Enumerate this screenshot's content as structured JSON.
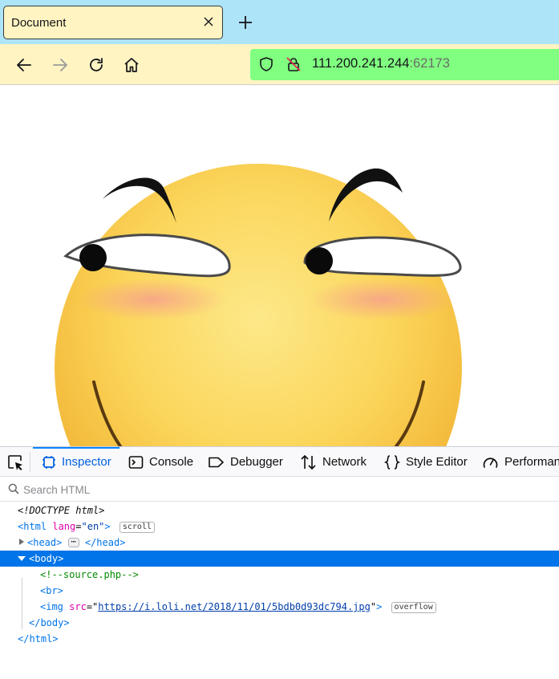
{
  "browser": {
    "tab_title": "Document",
    "nav": {
      "back_icon": "back-arrow-icon",
      "forward_icon": "forward-arrow-icon",
      "reload_icon": "reload-icon",
      "home_icon": "home-icon"
    },
    "url": {
      "host": "111.200.241.244",
      "port": ":62173"
    },
    "colors": {
      "tabstrip": "#aee4f8",
      "toolbar": "#fff4c2",
      "urlbar": "#80ff80"
    }
  },
  "page": {
    "image": {
      "alt_icon": "smirking-face-emoji"
    }
  },
  "devtools": {
    "tabs": [
      {
        "label": "Inspector",
        "icon": "inspector-icon",
        "active": true
      },
      {
        "label": "Console",
        "icon": "console-icon",
        "active": false
      },
      {
        "label": "Debugger",
        "icon": "debugger-icon",
        "active": false
      },
      {
        "label": "Network",
        "icon": "network-icon",
        "active": false
      },
      {
        "label": "Style Editor",
        "icon": "style-editor-icon",
        "active": false
      },
      {
        "label": "Performan",
        "icon": "performance-icon",
        "active": false
      }
    ],
    "search_placeholder": "Search HTML",
    "markup": {
      "doctype": "<!DOCTYPE html>",
      "html_open_tag": "<html",
      "html_attr_name": "lang",
      "html_attr_value": "\"en\"",
      "html_open_close": ">",
      "scroll_badge": "scroll",
      "head_open": "<head>",
      "head_dots": "⋯",
      "head_close": "</head>",
      "body_open": "<body>",
      "comment": "<!--source.php-->",
      "br": "<br>",
      "img_open": "<img",
      "img_attr_name": "src",
      "img_attr_eq": "=\"",
      "img_src": "https://i.loli.net/2018/11/01/5bdb0d93dc794.jpg",
      "img_attr_end": "\"",
      "img_close": ">",
      "overflow_badge": "overflow",
      "body_close": "</body>",
      "html_close": "</html>"
    }
  }
}
